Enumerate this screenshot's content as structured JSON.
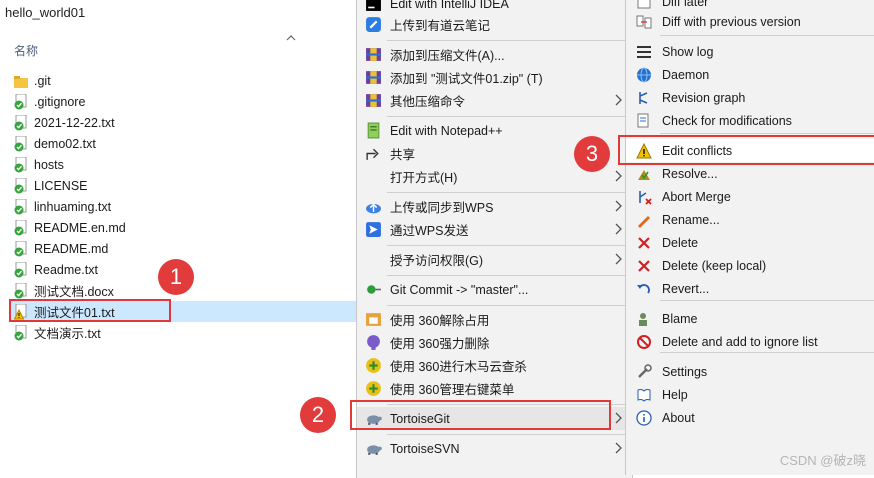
{
  "explorer": {
    "title": "hello_world01",
    "column_header": "名称",
    "files": [
      {
        "name": ".git",
        "icon": "folder-icon"
      },
      {
        "name": ".gitignore",
        "icon": "git-ok-file-icon"
      },
      {
        "name": "2021-12-22.txt",
        "icon": "git-ok-file-icon"
      },
      {
        "name": "demo02.txt",
        "icon": "git-ok-file-icon"
      },
      {
        "name": "hosts",
        "icon": "git-ok-file-icon"
      },
      {
        "name": "LICENSE",
        "icon": "git-ok-file-icon"
      },
      {
        "name": "linhuaming.txt",
        "icon": "git-ok-file-icon"
      },
      {
        "name": "README.en.md",
        "icon": "git-ok-file-icon"
      },
      {
        "name": "README.md",
        "icon": "git-ok-file-icon"
      },
      {
        "name": "Readme.txt",
        "icon": "git-ok-file-icon"
      },
      {
        "name": "测试文档.docx",
        "icon": "git-ok-file-icon"
      },
      {
        "name": "测试文件01.txt",
        "icon": "git-conflict-file-icon"
      },
      {
        "name": "文档演示.txt",
        "icon": "git-ok-file-icon"
      }
    ]
  },
  "menu1": {
    "items": [
      {
        "label": "Edit with IntelliJ IDEA",
        "icon": "intellij-icon"
      },
      {
        "label": "上传到有道云笔记",
        "icon": "youdao-icon"
      },
      {
        "label": "添加到压缩文件(A)...",
        "icon": "archive-icon"
      },
      {
        "label": "添加到 \"测试文件01.zip\" (T)",
        "icon": "archive-icon"
      },
      {
        "label": "其他压缩命令",
        "icon": "archive-icon"
      },
      {
        "label": "Edit with Notepad++",
        "icon": "notepad-plus-icon"
      },
      {
        "label": "共享",
        "icon": "share-icon"
      },
      {
        "label": "打开方式(H)",
        "icon": ""
      },
      {
        "label": "上传或同步到WPS",
        "icon": "cloud-upload-icon"
      },
      {
        "label": "通过WPS发送",
        "icon": "wps-send-icon"
      },
      {
        "label": "授予访问权限(G)",
        "icon": ""
      },
      {
        "label": "Git Commit -> \"master\"...",
        "icon": "git-commit-icon"
      },
      {
        "label": "使用 360解除占用",
        "icon": "unlock-360-icon"
      },
      {
        "label": "使用 360强力删除",
        "icon": "delete-360-icon"
      },
      {
        "label": "使用 360进行木马云查杀",
        "icon": "scan-360-icon"
      },
      {
        "label": "使用 360管理右键菜单",
        "icon": "manage-360-icon"
      },
      {
        "label": "TortoiseGit",
        "icon": "tortoisegit-icon"
      },
      {
        "label": "TortoiseSVN",
        "icon": "tortoisesvn-icon"
      }
    ]
  },
  "menu2": {
    "items": [
      {
        "label": "Diff later",
        "icon": "diff-later-icon"
      },
      {
        "label": "Diff with previous version",
        "icon": "diff-icon"
      },
      {
        "label": "Show log",
        "icon": "log-icon"
      },
      {
        "label": "Daemon",
        "icon": "daemon-icon"
      },
      {
        "label": "Revision graph",
        "icon": "revision-graph-icon"
      },
      {
        "label": "Check for modifications",
        "icon": "check-modifications-icon"
      },
      {
        "label": "Edit conflicts",
        "icon": "conflict-icon"
      },
      {
        "label": "Resolve...",
        "icon": "resolve-icon"
      },
      {
        "label": "Abort Merge",
        "icon": "abort-merge-icon"
      },
      {
        "label": "Rename...",
        "icon": "rename-icon"
      },
      {
        "label": "Delete",
        "icon": "delete-icon"
      },
      {
        "label": "Delete (keep local)",
        "icon": "delete-keep-icon"
      },
      {
        "label": "Revert...",
        "icon": "revert-icon"
      },
      {
        "label": "Blame",
        "icon": "blame-icon"
      },
      {
        "label": "Delete and add to ignore list",
        "icon": "ignore-icon"
      },
      {
        "label": "Settings",
        "icon": "settings-icon"
      },
      {
        "label": "Help",
        "icon": "help-icon"
      },
      {
        "label": "About",
        "icon": "about-icon"
      }
    ]
  },
  "annotations": {
    "badge1": "1",
    "badge2": "2",
    "badge3": "3"
  },
  "watermark": "CSDN @破z晓",
  "colors": {
    "accent_red": "#e0393c",
    "selection": "#cce8ff",
    "menu_bg": "#f2f2f2"
  }
}
